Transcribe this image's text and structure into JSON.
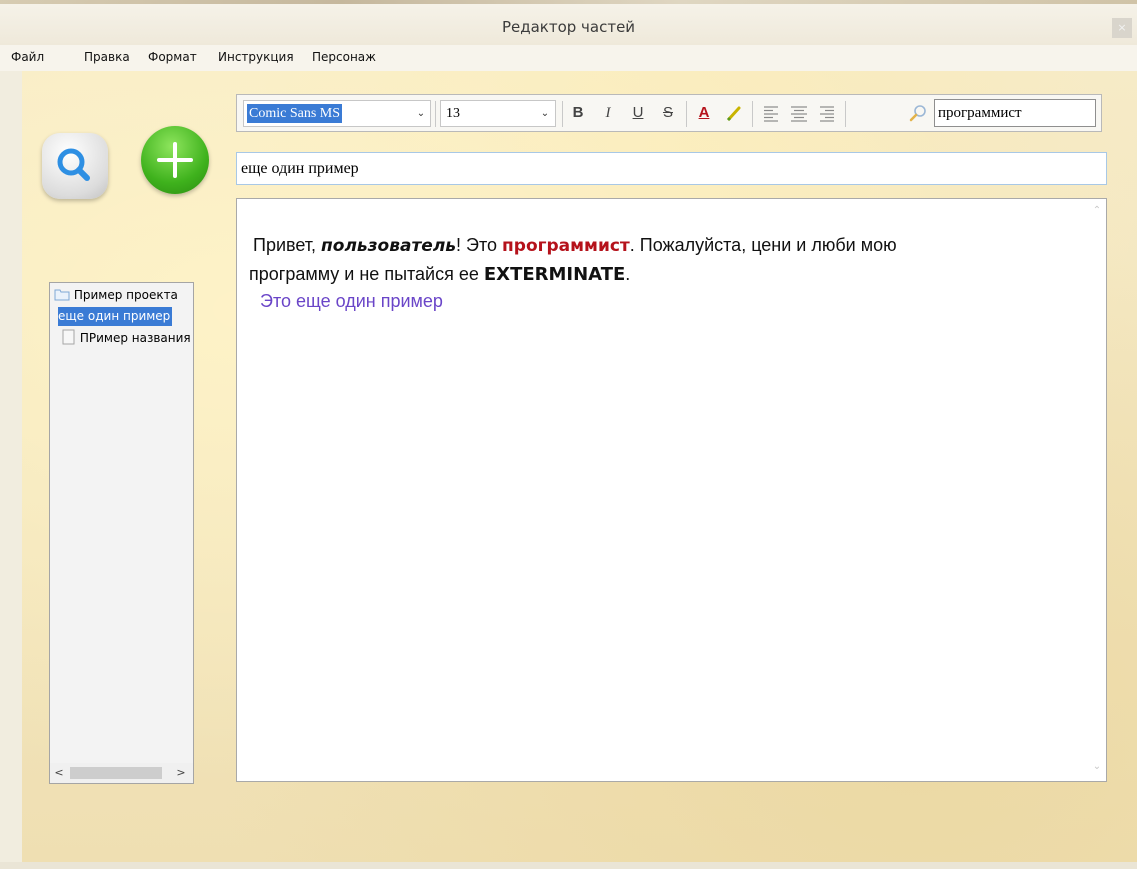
{
  "window": {
    "title": "Редактор частей",
    "close_glyph": "×"
  },
  "menu": [
    {
      "label": "Файл"
    },
    {
      "label": "Правка"
    },
    {
      "label": "Формат"
    },
    {
      "label": "Инструкция"
    },
    {
      "label": "Персонаж"
    }
  ],
  "toolbar": {
    "font_family": "Comic Sans MS",
    "font_size": "13",
    "bold_label": "B",
    "italic_label": "I",
    "underline_label": "U",
    "strike_label": "S",
    "font_color_label": "A",
    "search_value": "программист"
  },
  "left_buttons": {
    "search_icon": "search-icon",
    "add_icon": "plus-icon"
  },
  "part_title": "еще один пример",
  "tree": {
    "items": [
      {
        "label": "Пример проекта",
        "icon": "folder-icon",
        "selected": false
      },
      {
        "label": "еще один пример",
        "icon": "",
        "selected": true
      },
      {
        "label": "ПРимер названия",
        "icon": "document-icon",
        "selected": false
      }
    ]
  },
  "editor": {
    "line1": {
      "a": "Привет, ",
      "b": "пользователь",
      "c": "! Это ",
      "d": "программист",
      "e": ". Пожалуйста, цени и люби мою"
    },
    "line2": {
      "a": "программу и не пытайся ее ",
      "b": "EXTERMINATE",
      "c": "."
    },
    "line3": "Это еще один пример"
  },
  "colors": {
    "accent_red": "#b5121b",
    "purple_text": "#6a45c8",
    "selection_blue": "#3a7bd5",
    "green_button": "#3fb21d"
  }
}
